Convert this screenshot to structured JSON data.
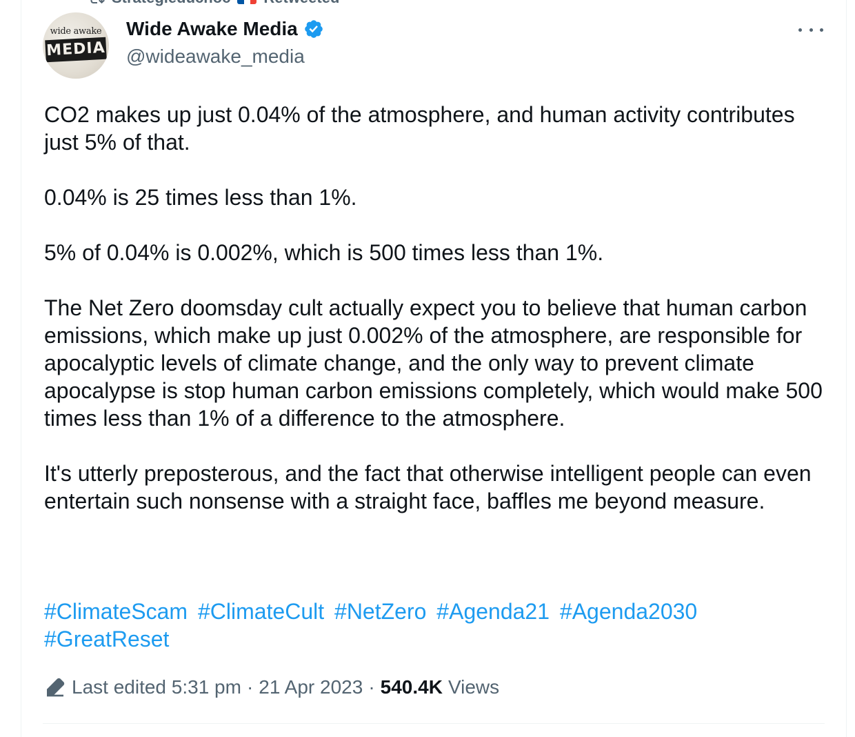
{
  "retweet": {
    "user": "Strategieduchoc",
    "label": "Retweeted",
    "flag_colors": [
      "#0055a4",
      "#ffffff",
      "#ef4135"
    ]
  },
  "author": {
    "avatar_text_top": "wide awake",
    "avatar_text_bottom": "MEDIA",
    "display_name": "Wide Awake Media",
    "handle": "@wideawake_media",
    "verified_color": "#1d9bf0"
  },
  "tweet": {
    "paragraphs": [
      "CO2 makes up just 0.04% of the atmosphere, and human activity contributes just 5% of that.",
      "0.04% is 25 times less than 1%.",
      "5% of 0.04% is 0.002%, which is 500 times less than 1%.",
      "The Net Zero doomsday cult actually expect you to believe that human carbon emissions, which make up just 0.002% of the atmosphere, are responsible for apocalyptic levels of climate change, and the only way to prevent climate apocalypse is stop human carbon emissions completely, which would make 500 times less than 1% of a difference to the atmosphere.",
      "It's utterly preposterous, and the fact that otherwise intelligent people can even entertain such nonsense with a straight face, baffles me beyond measure."
    ],
    "hashtags": [
      "#ClimateScam",
      "#ClimateCult",
      "#NetZero",
      "#Agenda21",
      "#Agenda2030",
      "#GreatReset"
    ],
    "link_color": "#1d9bf0"
  },
  "meta": {
    "edited_label": "Last edited 5:31 pm",
    "separator": "·",
    "date": "21 Apr 2023",
    "views_count": "540.4K",
    "views_label": "Views"
  }
}
